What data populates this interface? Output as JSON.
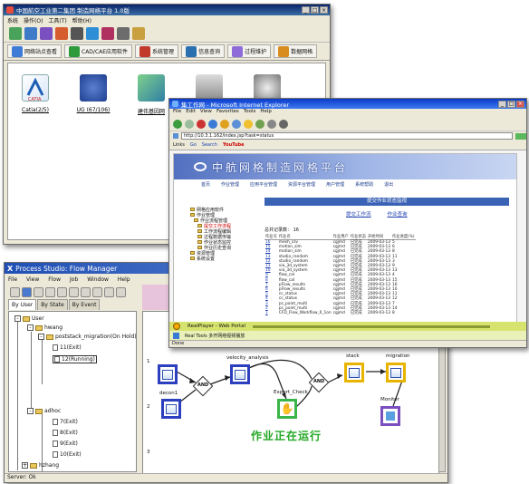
{
  "w1": {
    "title": "中国航空工业第二集团  制造网络平台 1.0版",
    "menus": [
      "系统",
      "操作(O)",
      "工具(T)",
      "帮助(H)"
    ],
    "modules": [
      {
        "label": "网络站点查看",
        "color": "#3e7bd6"
      },
      {
        "label": "CAD/CAE应用软件",
        "color": "#2f9a3a"
      },
      {
        "label": "系统管理",
        "color": "#c0392b"
      },
      {
        "label": "信息查询",
        "color": "#2a6fb0"
      },
      {
        "label": "过程维护",
        "color": "#8e6bd8"
      },
      {
        "label": "数据网格",
        "color": "#d98c1e"
      }
    ],
    "apps": [
      {
        "label": "Catia(2/5)",
        "color": "#1d5fb5"
      },
      {
        "label": "UG (67/106)",
        "color": "#1f3f8f"
      },
      {
        "label": "建伟基因网",
        "color": "#3a9b54"
      },
      {
        "label": "",
        "color": "#6d6d6d"
      },
      {
        "label": "",
        "color": "#8a8a8a"
      }
    ]
  },
  "w2": {
    "title": "集工作网 - Microsoft Internet Explorer",
    "menus": [
      "File",
      "Edit",
      "View",
      "Favorites",
      "Tools",
      "Help"
    ],
    "address": "http://10.3.1.162/index.jsp?task=status",
    "links": [
      "Links",
      "Go",
      "Search",
      "YouTube"
    ],
    "banner": "中航网格制造网格平台",
    "nav": [
      "首页",
      "作业管理",
      "应用平台管理",
      "资源平台管理",
      "用户管理",
      "系统帮助",
      "退出"
    ],
    "section": "提交作业状态监视",
    "actions": [
      "提交工作流",
      "作业查询"
    ],
    "total": "总共记录数：   16",
    "side": [
      "网格应用软件",
      "作业管理",
      "作业流程管理",
      "提交工作流程",
      "工作流程编辑",
      "过程数据传输",
      "作业状态监控",
      "作业历史查询",
      "资源管理",
      "系统设置"
    ],
    "columns": [
      "作业号",
      "作业名",
      "作业用户",
      "作业状态",
      "开始时间",
      "作业进度(%)"
    ],
    "rows": [
      [
        "16",
        "mesh_csv",
        "cgjmd",
        "已完成",
        "2009-03-13",
        "5"
      ],
      [
        "15",
        "motion_sim",
        "cgjmd",
        "已完成",
        "2009-03-13",
        "6"
      ],
      [
        "14",
        "motion_sim",
        "cgjmd",
        "已完成",
        "2009-03-13",
        "8"
      ],
      [
        "13",
        "studio_random",
        "cgjmd",
        "已完成",
        "2009-03-13",
        "11"
      ],
      [
        "12",
        "studio_random",
        "cgjmd",
        "已完成",
        "2009-03-13",
        "3"
      ],
      [
        "11",
        "via_3d_system",
        "cgjmd",
        "已完成",
        "2009-03-13",
        "9"
      ],
      [
        "10",
        "via_3d_system",
        "cgjmd",
        "已完成",
        "2009-03-13",
        "13"
      ],
      [
        "9",
        "flow_cal",
        "cgjmd",
        "已完成",
        "2009-03-13",
        "4"
      ],
      [
        "8",
        "flow_cal",
        "cgjmd",
        "已完成",
        "2009-03-13",
        "15"
      ],
      [
        "7",
        "pFlow_results",
        "cgjmd",
        "已完成",
        "2009-03-13",
        "16"
      ],
      [
        "6",
        "pFlow_results",
        "cgjmd",
        "已完成",
        "2009-03-13",
        "10"
      ],
      [
        "5",
        "cc_status",
        "cgjmd",
        "已完成",
        "2009-03-13",
        "11"
      ],
      [
        "4",
        "cc_status",
        "cgjmd",
        "已完成",
        "2009-03-13",
        "12"
      ],
      [
        "3",
        "pc_point_multi",
        "cgjmd",
        "已完成",
        "2009-03-13",
        "7"
      ],
      [
        "2",
        "pc_point_multi",
        "cgjmd",
        "已完成",
        "2009-03-13",
        "14"
      ],
      [
        "1",
        "CFD_Flow_Workflow_0_1on",
        "cgjmd",
        "已完成",
        "2009-03-13",
        "8"
      ]
    ],
    "player_title": "RealPlayer - Web Portal",
    "player_sub": "Real Tools   多开网络视频播放",
    "status": "Done"
  },
  "w3": {
    "title": "Process Studio: Flow Manager",
    "menus": [
      "File",
      "View",
      "Flow",
      "Job",
      "Window",
      "Help"
    ],
    "tabs": [
      "By User",
      "By State",
      "By Event"
    ],
    "tree": {
      "root": "User",
      "u1": "hwang",
      "job": "poststack_migration(On Hold)",
      "j11": "11(Exit)",
      "j12": "12(Running)",
      "u2": "adhoc",
      "a7": "7(Exit)",
      "a8": "8(Exit)",
      "a9": "9(Exit)",
      "a10": "10(Exit)",
      "u3": "hzhang"
    },
    "rownums": [
      "1",
      "2",
      "3"
    ],
    "nodes": {
      "n1": "velocity_analysis",
      "n2": "Expert_Check",
      "n3": "stack",
      "n4": "migration",
      "n5": "Monitor",
      "n6": "decon1",
      "and": "AND"
    },
    "running": "作业正在运行",
    "status": "Server: Ok"
  }
}
